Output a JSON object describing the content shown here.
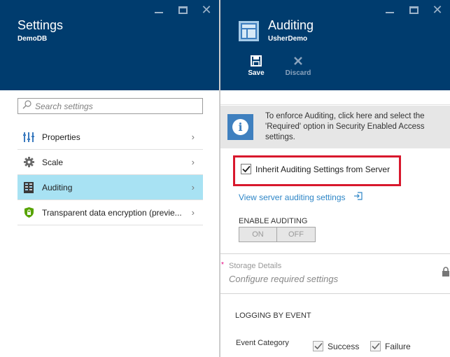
{
  "settings_blade": {
    "title": "Settings",
    "subtitle": "DemoDB",
    "search_placeholder": "Search settings",
    "items": [
      {
        "label": "Properties",
        "icon": "properties-icon"
      },
      {
        "label": "Scale",
        "icon": "gear-icon"
      },
      {
        "label": "Auditing",
        "icon": "auditing-icon",
        "active": true
      },
      {
        "label": "Transparent data encryption (previe...",
        "icon": "shield-lock-icon"
      }
    ],
    "chevron": "›"
  },
  "auditing_blade": {
    "title": "Auditing",
    "subtitle": "UsherDemo",
    "commands": {
      "save": "Save",
      "discard": "Discard"
    },
    "info_text": "To enforce Auditing, click here and select the 'Required' option in Security Enabled Access settings.",
    "inherit_label": "Inherit Auditing Settings from Server",
    "inherit_checked": true,
    "server_link": "View server auditing settings",
    "enable_auditing": {
      "label": "ENABLE AUDITING",
      "on": "ON",
      "off": "OFF"
    },
    "storage": {
      "required_marker": "*",
      "label": "Storage Details",
      "value": "Configure required settings"
    },
    "logging": {
      "title": "LOGGING BY EVENT",
      "event_category": "Event Category",
      "success": "Success",
      "failure": "Failure"
    }
  },
  "colors": {
    "header_bg": "#003c6e",
    "active_item_bg": "#a8e2f3",
    "highlight_border": "#d8182d",
    "link": "#2e86c7",
    "info_icon_bg": "#3f80bf"
  }
}
